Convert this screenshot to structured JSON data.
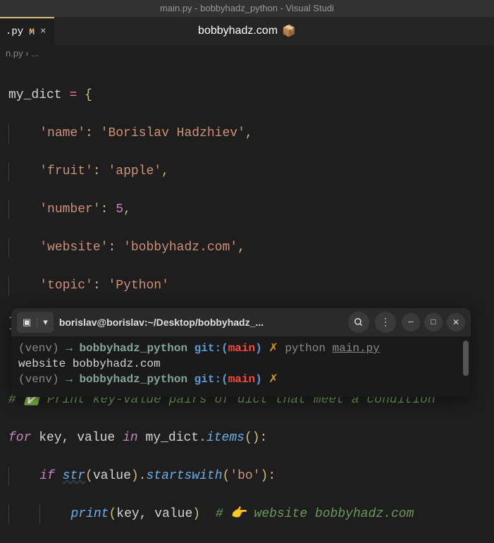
{
  "titlebar": "main.py - bobbyhadz_python - Visual Studi",
  "tab": {
    "label": ".py",
    "modified": "M",
    "close": "×"
  },
  "center_title": "bobbyhadz.com",
  "center_emoji": "📦",
  "breadcrumb": {
    "file": "n.py",
    "sep": "›",
    "rest": "..."
  },
  "code": {
    "l1": {
      "var": "my_dict",
      "op": "=",
      "brace": "{"
    },
    "l2": {
      "k": "'name'",
      "v": "'Borislav Hadzhiev'"
    },
    "l3": {
      "k": "'fruit'",
      "v": "'apple'"
    },
    "l4": {
      "k": "'number'",
      "v": "5"
    },
    "l5": {
      "k": "'website'",
      "v": "'bobbyhadz.com'"
    },
    "l6": {
      "k": "'topic'",
      "v": "'Python'"
    },
    "l7": {
      "brace": "}"
    },
    "l8": {
      "comment": "# ✅ Print key-value pairs of dict that meet a condition"
    },
    "l9": {
      "for": "for",
      "vars": "key, value",
      "in": "in",
      "obj": "my_dict",
      "meth": "items"
    },
    "l10": {
      "if": "if",
      "fn": "str",
      "arg": "value",
      "meth": "startswith",
      "sarg": "'bo'"
    },
    "l11": {
      "fn": "print",
      "args": "key, value",
      "comment": "# 👉 website bobbyhadz.com"
    }
  },
  "terminal": {
    "title": "borislav@borislav:~/Desktop/bobbyhadz_...",
    "lines": {
      "l1": {
        "venv": "(venv)",
        "arrow": "→",
        "dir": "bobbyhadz_python",
        "git": "git:(",
        "branch": "main",
        "git2": ")",
        "flash": "✗",
        "cmd": "python",
        "arg": "main.py"
      },
      "l2": "website bobbyhadz.com",
      "l3": {
        "venv": "(venv)",
        "arrow": "→",
        "dir": "bobbyhadz_python",
        "git": "git:(",
        "branch": "main",
        "git2": ")",
        "flash": "✗"
      }
    }
  }
}
